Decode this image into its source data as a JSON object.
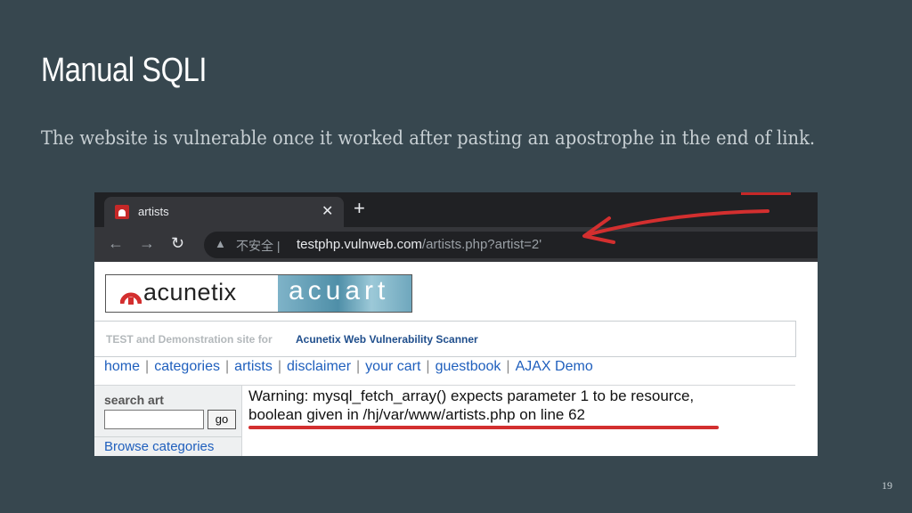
{
  "slide": {
    "title": "Manual SQLI",
    "body": "The website is vulnerable once it worked after pasting an apostrophe in the end of link.",
    "page_number": "19"
  },
  "browser": {
    "tab_title": "artists",
    "close_symbol": "✕",
    "new_tab_symbol": "+",
    "security_label": "不安全 |",
    "url_host": "testphp.vulnweb.com",
    "url_path": "/artists.php?artist=2'",
    "icons": [
      "back-icon",
      "forward-icon",
      "reload-icon",
      "warning-icon"
    ]
  },
  "site": {
    "logo_left": "acunetix",
    "logo_right": "acuart",
    "banner_prefix": "TEST and Demonstration site for",
    "banner_link": "Acunetix Web Vulnerability Scanner",
    "menu": [
      "home",
      "categories",
      "artists",
      "disclaimer",
      "your cart",
      "guestbook",
      "AJAX Demo"
    ],
    "search_label": "search art",
    "go_label": "go",
    "browse_label": "Browse categories",
    "warning_line1": "Warning: mysql_fetch_array() expects parameter 1 to be resource,",
    "warning_line2": "boolean given in /hj/var/www/artists.php on line 62"
  },
  "colors": {
    "slide_bg": "#37474f",
    "annotation_red": "#d32f2f",
    "link_blue": "#1f5fbd"
  }
}
